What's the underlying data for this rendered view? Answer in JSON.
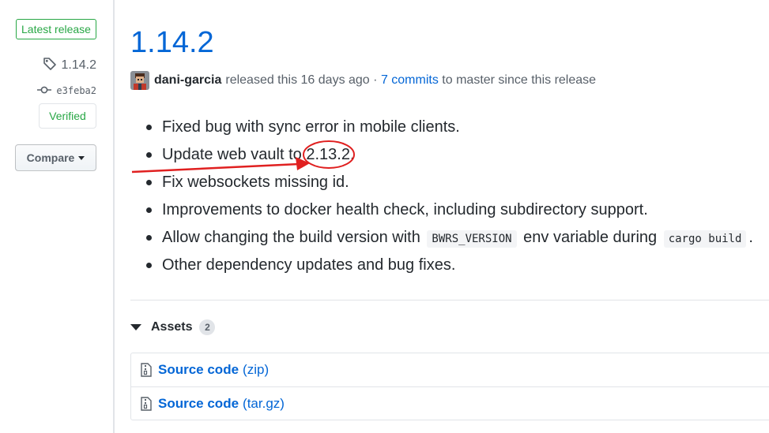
{
  "sidebar": {
    "latest_label": "Latest release",
    "tag": "1.14.2",
    "tag_icon": "tag-icon",
    "commit": "e3feba2",
    "commit_icon": "git-commit-icon",
    "verified_label": "Verified",
    "compare_label": "Compare"
  },
  "release": {
    "title": "1.14.2",
    "author": "dani-garcia",
    "released_text": "released this 16 days ago ·",
    "commits_link": "7 commits",
    "since_text": "to master since this release"
  },
  "notes": {
    "item1": "Fixed bug with sync error in mobile clients.",
    "item2_prefix": "Update web vault to ",
    "item2_version": "2.13.2.",
    "item3": "Fix websockets missing id.",
    "item4": "Improvements to docker health check, including subdirectory support.",
    "item5_prefix": "Allow changing the build version with",
    "item5_code1": "BWRS_VERSION",
    "item5_middle": "env variable during",
    "item5_code2": "cargo build",
    "item5_suffix": ".",
    "item6": "Other dependency updates and bug fixes."
  },
  "assets": {
    "label": "Assets",
    "count": "2",
    "items": [
      {
        "name": "Source code",
        "format": "(zip)"
      },
      {
        "name": "Source code",
        "format": "(tar.gz)"
      }
    ]
  },
  "colors": {
    "link": "#0366d6",
    "success": "#28a745",
    "annotation": "#e02020"
  }
}
